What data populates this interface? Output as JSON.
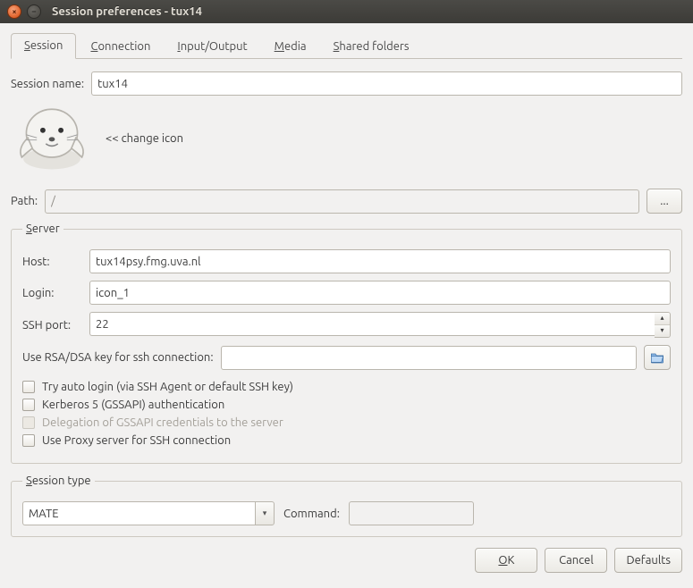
{
  "window": {
    "title": "Session preferences - tux14"
  },
  "tabs": [
    {
      "label_pre": "",
      "accel": "S",
      "label_post": "ession",
      "active": true
    },
    {
      "label_pre": "",
      "accel": "C",
      "label_post": "onnection",
      "active": false
    },
    {
      "label_pre": "",
      "accel": "I",
      "label_post": "nput/Output",
      "active": false
    },
    {
      "label_pre": "",
      "accel": "M",
      "label_post": "edia",
      "active": false
    },
    {
      "label_pre": "",
      "accel": "S",
      "label_post": "hared folders",
      "active": false
    }
  ],
  "session_name": {
    "label": "Session name:",
    "value": "tux14"
  },
  "change_icon_label": "<< change icon",
  "path": {
    "label": "Path:",
    "value": "/",
    "browse_label": "..."
  },
  "server": {
    "legend_accel": "S",
    "legend_post": "erver",
    "host_label": "Host:",
    "host_value": "tux14psy.fmg.uva.nl",
    "login_label": "Login:",
    "login_value": "icon_1",
    "sshport_label": "SSH port:",
    "sshport_value": "22",
    "rsa_label": "Use RSA/DSA key for ssh connection:",
    "rsa_value": "",
    "checks": {
      "auto_login": "Try auto login (via SSH Agent or default SSH key)",
      "kerberos": "Kerberos 5 (GSSAPI) authentication",
      "delegation": "Delegation of GSSAPI credentials to the server",
      "proxy": "Use Proxy server for SSH connection"
    }
  },
  "session_type": {
    "legend_accel": "S",
    "legend_post": "ession type",
    "value": "MATE",
    "command_label": "Command:",
    "command_value": ""
  },
  "footer": {
    "ok_accel": "O",
    "ok_post": "K",
    "cancel": "Cancel",
    "defaults": "Defaults"
  }
}
